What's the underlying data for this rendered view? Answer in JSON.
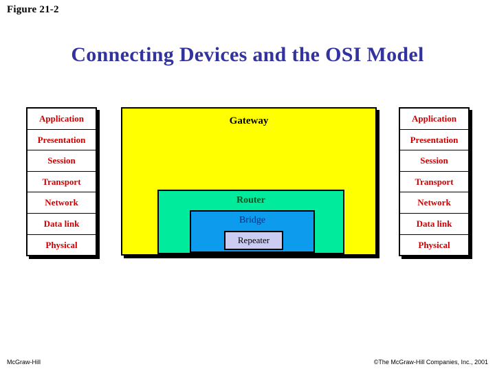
{
  "figure": {
    "label": "Figure 21-2"
  },
  "title": {
    "text": "Connecting Devices and the OSI Model",
    "color": "#3333a0"
  },
  "osi_stacks": {
    "layer_text_color": "#cc0000",
    "left": {
      "layers": [
        "Application",
        "Presentation",
        "Session",
        "Transport",
        "Network",
        "Data link",
        "Physical"
      ]
    },
    "right": {
      "layers": [
        "Application",
        "Presentation",
        "Session",
        "Transport",
        "Network",
        "Data link",
        "Physical"
      ]
    }
  },
  "devices": {
    "gateway": {
      "label": "Gateway",
      "fill": "#ffff00",
      "text_color": "#000000"
    },
    "router": {
      "label": "Router",
      "fill": "#00eb9b",
      "text_color": "#005522"
    },
    "bridge": {
      "label": "Bridge",
      "fill": "#0d9ced",
      "text_color": "#102a7a"
    },
    "repeater": {
      "label": "Repeater",
      "fill": "#ccccf2",
      "text_color": "#000000"
    }
  },
  "footer": {
    "left": "McGraw-Hill",
    "right": "©The McGraw-Hill Companies, Inc., 2001"
  }
}
